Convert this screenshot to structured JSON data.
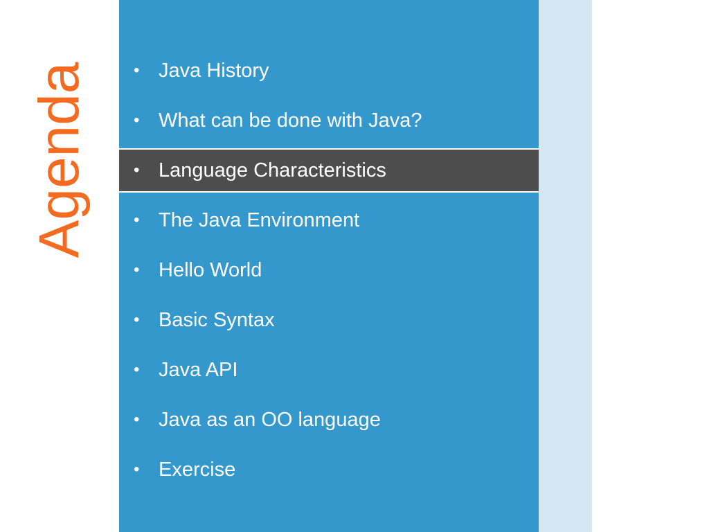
{
  "slide": {
    "title": "Agenda",
    "colors": {
      "title": "#f26b21",
      "panel": "#3498cc",
      "strip": "#d4e7f3",
      "active_item": "#4d4d4d"
    }
  },
  "agenda": {
    "bullet": "•",
    "active_index": 2,
    "items": [
      {
        "label": "Java History"
      },
      {
        "label": "What can be done with Java?"
      },
      {
        "label": "Language Characteristics"
      },
      {
        "label": "The Java Environment"
      },
      {
        "label": "Hello World"
      },
      {
        "label": "Basic Syntax"
      },
      {
        "label": "Java API"
      },
      {
        "label": "Java as an OO language"
      },
      {
        "label": "Exercise"
      }
    ]
  }
}
